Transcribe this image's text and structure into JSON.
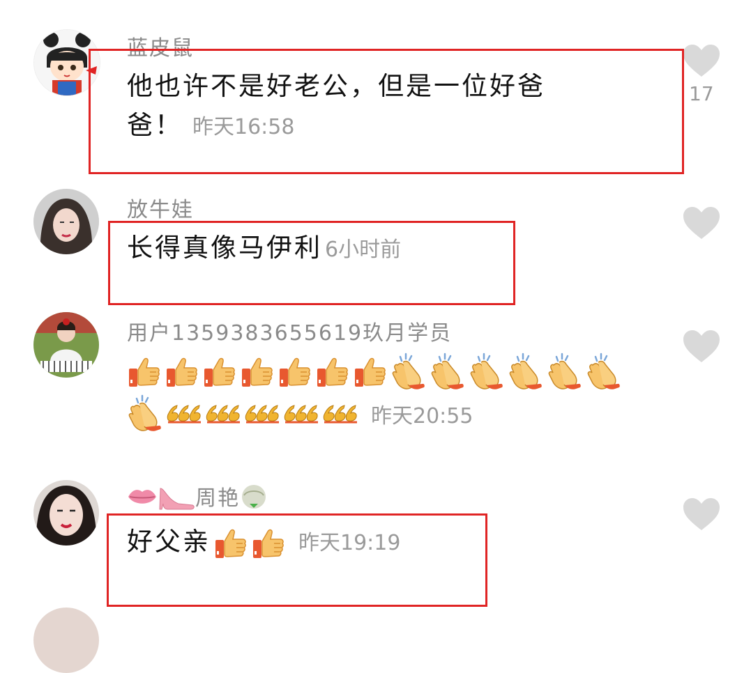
{
  "comments": [
    {
      "username": "蓝皮鼠",
      "text_line1": "他也许不是好老公，但是一位好爸",
      "text_line2": "爸！",
      "time": "昨天16:58",
      "likes": "17",
      "avatar": "cartoon-girl-avatar"
    },
    {
      "username": "放牛娃",
      "text": "长得真像马伊利",
      "time": "6小时前",
      "avatar": "woman-photo-avatar"
    },
    {
      "username": "用户1359383655619玖月学员",
      "emoji_line1": [
        "thumbs-up",
        "thumbs-up",
        "thumbs-up",
        "thumbs-up",
        "thumbs-up",
        "thumbs-up",
        "thumbs-up",
        "clapping-hands",
        "clapping-hands",
        "clapping-hands",
        "clapping-hands",
        "clapping-hands",
        "clapping-hands"
      ],
      "emoji_line2": [
        "clapping-hands",
        "666",
        "666",
        "666",
        "666",
        "666"
      ],
      "time": "昨天20:55",
      "avatar": "girl-piano-avatar"
    },
    {
      "username": "周艳",
      "username_prefix_icons": [
        "lips-icon",
        "high-heel-icon"
      ],
      "username_suffix_icons": [
        "rice-dumpling-icon"
      ],
      "text": "好父亲",
      "text_emojis": [
        "thumbs-up",
        "thumbs-up"
      ],
      "time": "昨天19:19",
      "avatar": "woman-closeup-avatar"
    }
  ],
  "colors": {
    "highlight_box": "#e02424",
    "username": "#8a8a8a",
    "timestamp": "#9a9a9a",
    "heart": "#d9d9d9"
  }
}
